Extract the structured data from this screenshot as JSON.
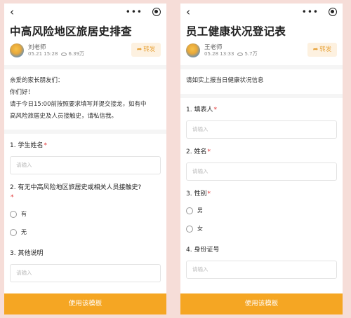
{
  "left": {
    "title": "中高风险地区旅居史排查",
    "author": {
      "name": "刘老师",
      "date": "05.21 15:28",
      "views": "6.39万"
    },
    "share_label": "转发",
    "intro": [
      "亲爱的家长朋友们：",
      "你们好！",
      "请于今日15:00前按照要求填写并提交接龙，如有中",
      "高风险旅居史及人员接触史，请私信我。"
    ],
    "questions": [
      {
        "label": "1. 学生姓名",
        "placeholder": "请输入"
      },
      {
        "label_line1": "2. 有无中高风险地区旅居史或相关人员接触史?",
        "options": [
          "有",
          "无"
        ]
      },
      {
        "label": "3. 其他说明",
        "placeholder": "请输入"
      }
    ],
    "use_button": "使用该模板"
  },
  "right": {
    "title": "员工健康状况登记表",
    "author": {
      "name": "王老师",
      "date": "05.28 13:33",
      "views": "5.7万"
    },
    "share_label": "转发",
    "intro": [
      "请如实上报当日健康状况信息"
    ],
    "questions": [
      {
        "label": "1. 填表人",
        "placeholder": "请输入"
      },
      {
        "label": "2. 姓名",
        "placeholder": "请输入"
      },
      {
        "label": "3. 性别",
        "options": [
          "男",
          "女"
        ]
      },
      {
        "label": "4. 身份证号",
        "placeholder": "请输入"
      }
    ],
    "use_button": "使用该模板"
  },
  "icons": {
    "back": "‹",
    "more": "•••"
  },
  "colors": {
    "accent": "#f5a623",
    "required": "#e03030",
    "background": "#f6ddd8"
  }
}
